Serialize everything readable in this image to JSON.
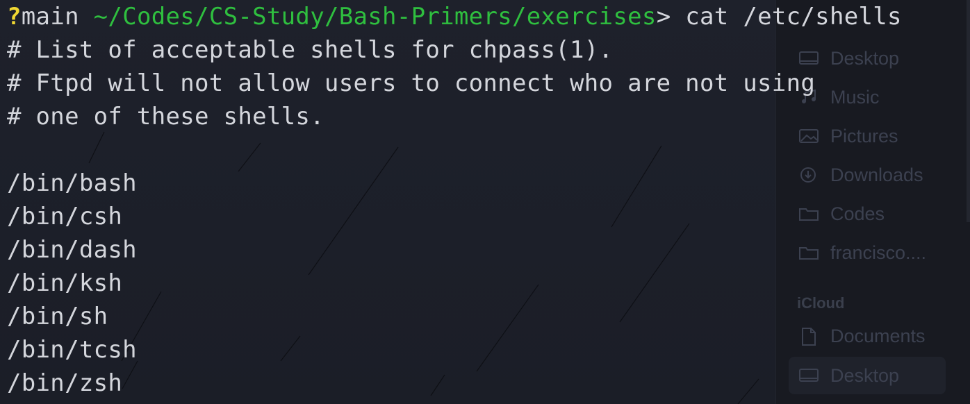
{
  "terminal": {
    "prompt": {
      "status_symbol": "?",
      "branch": "main",
      "cwd": "~/Codes/CS-Study/Bash-Primers/exercises",
      "separator": ">",
      "command": "cat /etc/shells"
    },
    "output": [
      "# List of acceptable shells for chpass(1).",
      "# Ftpd will not allow users to connect who are not using",
      "# one of these shells.",
      "",
      "/bin/bash",
      "/bin/csh",
      "/bin/dash",
      "/bin/ksh",
      "/bin/sh",
      "/bin/tcsh",
      "/bin/zsh"
    ]
  },
  "sidebar": {
    "items": [
      {
        "label": "Desktop",
        "icon": "desktop-icon"
      },
      {
        "label": "Music",
        "icon": "music-icon"
      },
      {
        "label": "Pictures",
        "icon": "pictures-icon"
      },
      {
        "label": "Downloads",
        "icon": "downloads-icon"
      },
      {
        "label": "Codes",
        "icon": "folder-icon"
      },
      {
        "label": "francisco....",
        "icon": "folder-icon"
      }
    ],
    "icloud_section": "iCloud",
    "icloud_items": [
      {
        "label": "Documents",
        "icon": "document-icon"
      },
      {
        "label": "Desktop",
        "icon": "desktop-icon",
        "selected": true
      }
    ]
  },
  "colors": {
    "background": "#1d2029",
    "prompt_symbol": "#f1d833",
    "path": "#2fbf3f",
    "text": "#d4d6dc"
  }
}
